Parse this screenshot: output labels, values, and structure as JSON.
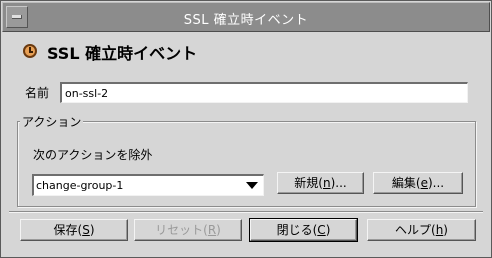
{
  "window": {
    "title": "SSL 確立時イベント"
  },
  "header": {
    "title": "SSL 確立時イベント",
    "icon": "clock-icon"
  },
  "form": {
    "name_label": "名前",
    "name_value": "on-ssl-2"
  },
  "actions_group": {
    "legend": "アクション",
    "exclude_label": "次のアクションを除外",
    "selected_action": "change-group-1",
    "new_button": {
      "label": "新規(",
      "mnemonic": "n",
      "suffix": ")..."
    },
    "edit_button": {
      "label": "編集(",
      "mnemonic": "e",
      "suffix": ")..."
    }
  },
  "footer": {
    "save": {
      "label": "保存(",
      "mnemonic": "S",
      "suffix": ")"
    },
    "reset": {
      "label": "リセット(",
      "mnemonic": "R",
      "suffix": ")"
    },
    "close": {
      "label": "閉じる(",
      "mnemonic": "C",
      "suffix": ")"
    },
    "help": {
      "label": "ヘルプ(",
      "mnemonic": "h",
      "suffix": ")"
    }
  }
}
